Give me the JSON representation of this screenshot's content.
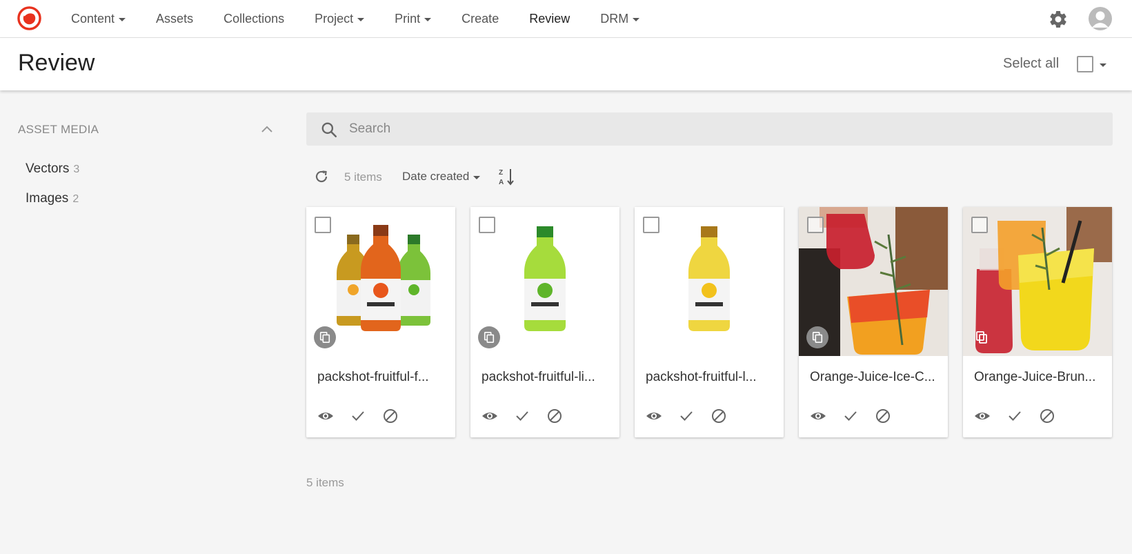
{
  "nav": {
    "items": [
      {
        "label": "Content",
        "dropdown": true
      },
      {
        "label": "Assets",
        "dropdown": false
      },
      {
        "label": "Collections",
        "dropdown": false
      },
      {
        "label": "Project",
        "dropdown": true
      },
      {
        "label": "Print",
        "dropdown": true
      },
      {
        "label": "Create",
        "dropdown": false
      },
      {
        "label": "Review",
        "dropdown": false,
        "active": true
      },
      {
        "label": "DRM",
        "dropdown": true
      }
    ],
    "accent_color": "#e8321e"
  },
  "header": {
    "title": "Review",
    "select_all_label": "Select all"
  },
  "sidebar": {
    "section_title": "ASSET MEDIA",
    "filters": [
      {
        "label": "Vectors",
        "count": "3"
      },
      {
        "label": "Images",
        "count": "2"
      }
    ]
  },
  "search": {
    "placeholder": "Search",
    "value": ""
  },
  "toolbar": {
    "items_count": "5 items",
    "sort_label": "Date created"
  },
  "cards": [
    {
      "name": "packshot-fruitful-f...",
      "thumb": "three-bottles"
    },
    {
      "name": "packshot-fruitful-li...",
      "thumb": "lime-bottle"
    },
    {
      "name": "packshot-fruitful-l...",
      "thumb": "lemon-bottle"
    },
    {
      "name": "Orange-Juice-Ice-C...",
      "thumb": "pouring-drink-photo"
    },
    {
      "name": "Orange-Juice-Brun...",
      "thumb": "juice-glasses-photo"
    }
  ],
  "footer": {
    "items_count": "5 items"
  }
}
